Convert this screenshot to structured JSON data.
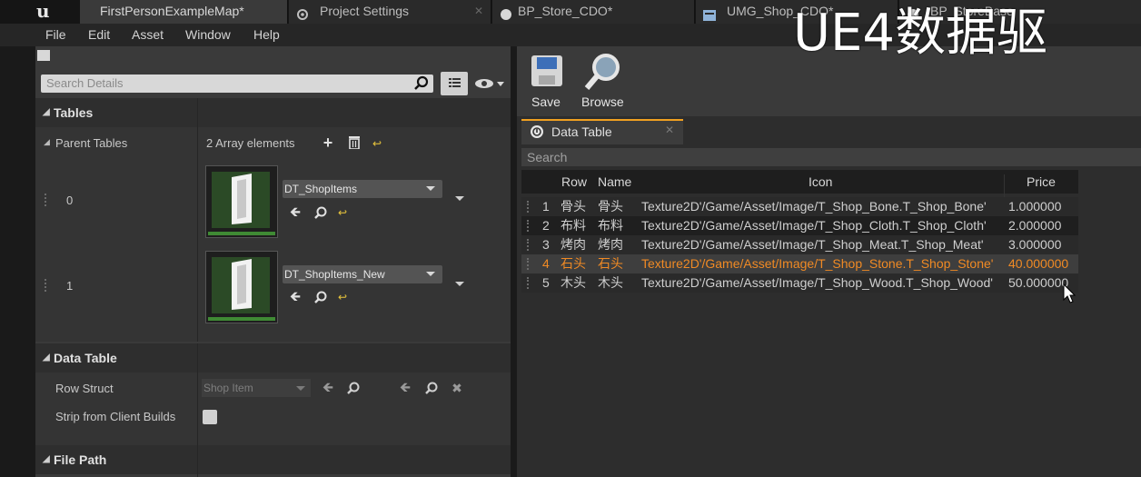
{
  "tabs": [
    {
      "label": "FirstPersonExampleMap*",
      "icon": "level-icon"
    },
    {
      "label": "Project Settings",
      "icon": "settings-icon"
    },
    {
      "label": "BP_Store_CDO*",
      "icon": "blueprint-icon"
    },
    {
      "label": "UMG_Shop_CDO*",
      "icon": "widget-icon"
    },
    {
      "label": "BP_StoreBase",
      "icon": "blueprint-icon"
    }
  ],
  "menu": [
    "File",
    "Edit",
    "Asset",
    "Window",
    "Help"
  ],
  "overlay_text": "UE4数据驱",
  "details": {
    "search_placeholder": "Search Details",
    "sections": {
      "tables": "Tables",
      "data_table": "Data Table",
      "file_path": "File Path"
    },
    "parent_tables": {
      "label": "Parent Tables",
      "count": "2 Array elements",
      "elements": [
        {
          "index": "0",
          "asset": "DT_ShopItems"
        },
        {
          "index": "1",
          "asset": "DT_ShopItems_New"
        }
      ]
    },
    "row_struct": {
      "label": "Row Struct",
      "value": "Shop Item"
    },
    "strip": {
      "label": "Strip from Client Builds",
      "checked": false
    }
  },
  "toolbar": {
    "save": "Save",
    "browse": "Browse"
  },
  "data_table": {
    "tab_label": "Data Table",
    "search_placeholder": "Search",
    "columns": [
      "Row",
      "Name",
      "Icon",
      "Price"
    ],
    "rows": [
      {
        "num": "1",
        "row": "骨头",
        "name": "骨头",
        "icon": "Texture2D'/Game/Asset/Image/T_Shop_Bone.T_Shop_Bone'",
        "price": "1.000000"
      },
      {
        "num": "2",
        "row": "布料",
        "name": "布料",
        "icon": "Texture2D'/Game/Asset/Image/T_Shop_Cloth.T_Shop_Cloth'",
        "price": "2.000000"
      },
      {
        "num": "3",
        "row": "烤肉",
        "name": "烤肉",
        "icon": "Texture2D'/Game/Asset/Image/T_Shop_Meat.T_Shop_Meat'",
        "price": "3.000000"
      },
      {
        "num": "4",
        "row": "石头",
        "name": "石头",
        "icon": "Texture2D'/Game/Asset/Image/T_Shop_Stone.T_Shop_Stone'",
        "price": "40.000000",
        "selected": true
      },
      {
        "num": "5",
        "row": "木头",
        "name": "木头",
        "icon": "Texture2D'/Game/Asset/Image/T_Shop_Wood.T_Shop_Wood'",
        "price": "50.000000"
      }
    ]
  },
  "colors": {
    "accent": "#f0a020",
    "selected_text": "#f08a24"
  }
}
